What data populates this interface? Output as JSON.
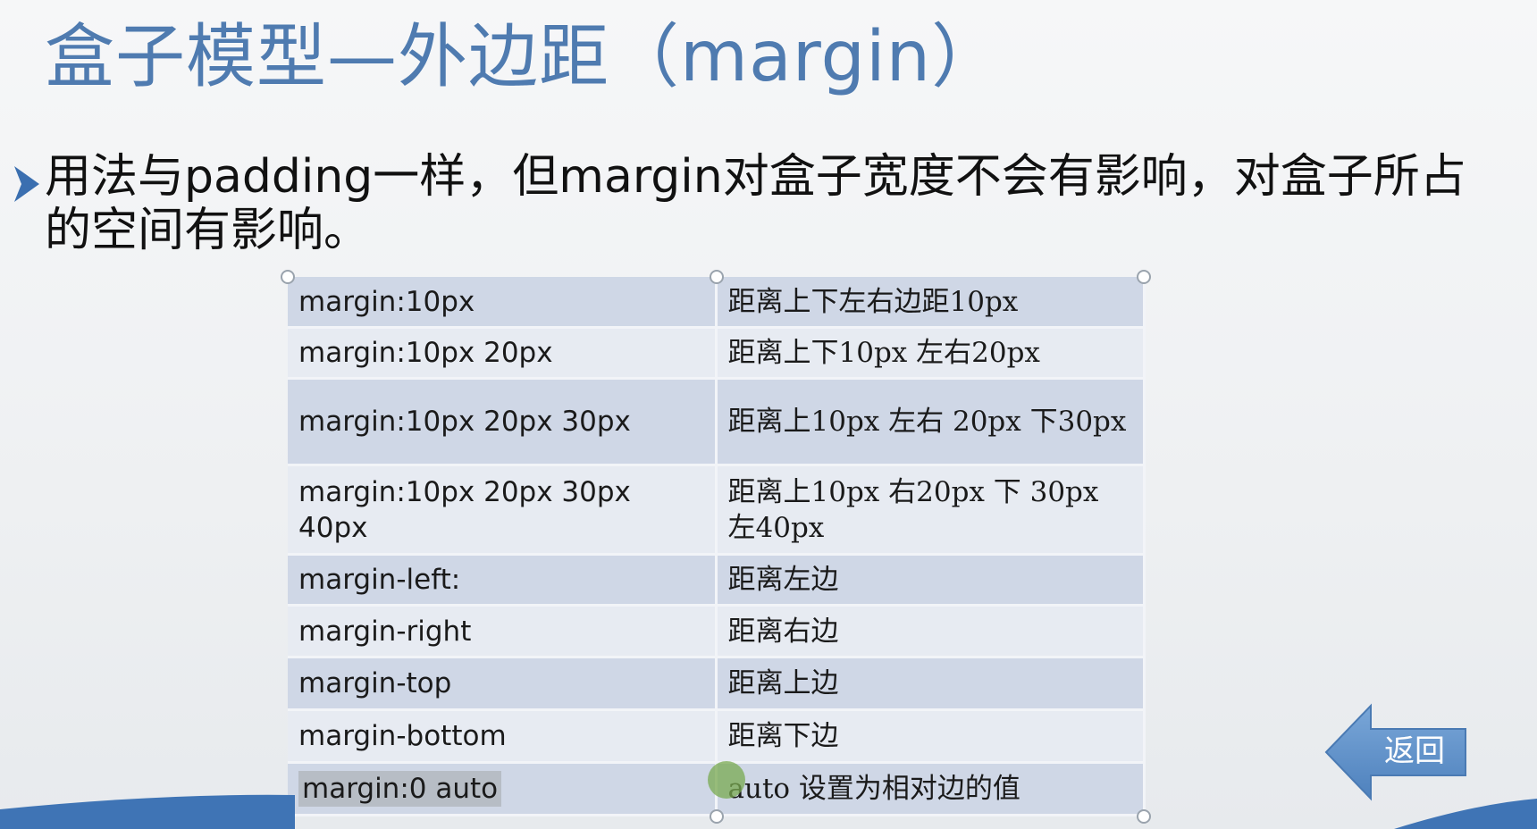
{
  "slide": {
    "title": "盒子模型—外边距（margin）",
    "bullet": "用法与padding一样，但margin对盒子宽度不会有影响，对盒子所占的空间有影响。"
  },
  "table": {
    "rows": [
      {
        "property": "margin:10px",
        "description": "距离上下左右边距10px"
      },
      {
        "property": "margin:10px  20px",
        "description": "距离上下10px   左右20px"
      },
      {
        "property": "margin:10px   20px  30px",
        "description": "距离上10px    左右 20px 下30px"
      },
      {
        "property": "margin:10px   20px   30px 40px",
        "description": "距离上10px   右20px   下 30px  左40px"
      },
      {
        "property": "margin-left:",
        "description": "距离左边"
      },
      {
        "property": "margin-right",
        "description": "距离右边"
      },
      {
        "property": "margin-top",
        "description": "距离上边"
      },
      {
        "property": "margin-bottom",
        "description": "距离下边"
      },
      {
        "property": "margin:0  auto",
        "description": "auto 设置为相对边的值"
      }
    ]
  },
  "navigation": {
    "back_label": "返回"
  },
  "colors": {
    "title": "#4f7bb0",
    "row_odd": "#cfd7e6",
    "row_even": "#e7ebf2",
    "back_button": "#5f90c8"
  },
  "icons": {
    "bullet": "triangle-arrow-icon",
    "back": "left-arrow-icon"
  }
}
